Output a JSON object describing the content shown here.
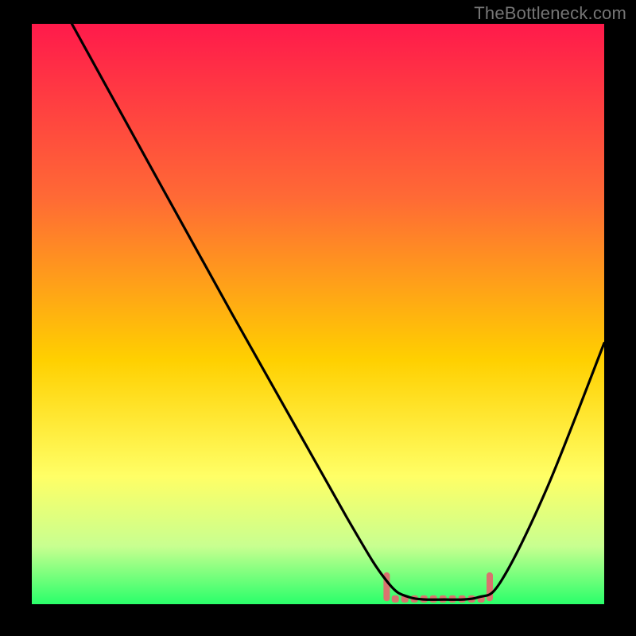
{
  "watermark": "TheBottleneck.com",
  "chart_data": {
    "type": "line",
    "title": "",
    "xlabel": "",
    "ylabel": "",
    "xlim": [
      0,
      100
    ],
    "ylim": [
      0,
      100
    ],
    "background_gradient": {
      "colors": [
        "#ff1a4b",
        "#ff6a35",
        "#ffd000",
        "#ffff66",
        "#c8ff90",
        "#2aff6a"
      ],
      "stops": [
        0,
        0.3,
        0.58,
        0.78,
        0.9,
        1.0
      ]
    },
    "curve": {
      "description": "V-shaped curve from top-left down to a flat minimum near x≈70 then rising to the right edge",
      "points_pct": [
        [
          7,
          100
        ],
        [
          35,
          50
        ],
        [
          55,
          15
        ],
        [
          62,
          4
        ],
        [
          66,
          1.2
        ],
        [
          72,
          0.8
        ],
        [
          78,
          1.2
        ],
        [
          82,
          4
        ],
        [
          90,
          20
        ],
        [
          100,
          45
        ]
      ]
    },
    "confidence_band": {
      "color": "#d9736f",
      "x_range_pct": [
        62,
        80
      ],
      "y_range_pct": [
        0.5,
        5.5
      ]
    }
  }
}
